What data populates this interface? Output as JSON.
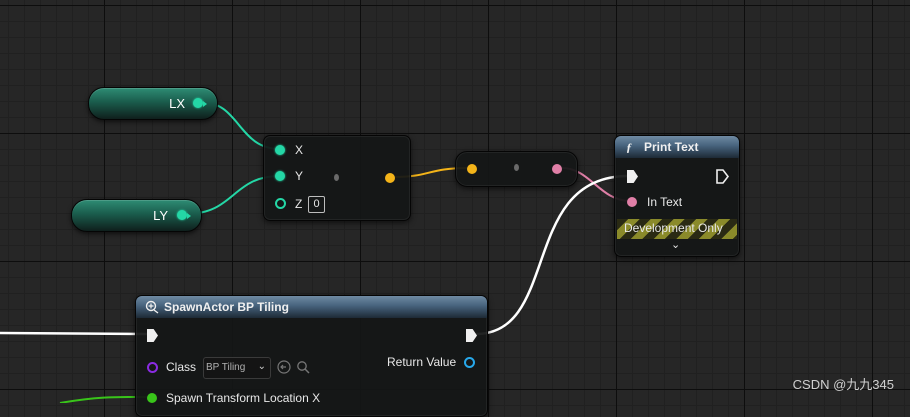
{
  "variables": [
    {
      "label": "LX"
    },
    {
      "label": "LY"
    }
  ],
  "make_vector": {
    "inputs": [
      "X",
      "Y",
      "Z"
    ],
    "z_value": "0"
  },
  "print_text": {
    "title": "Print Text",
    "in_text_label": "In Text",
    "dev_label": "Development Only"
  },
  "spawn_actor": {
    "title": "SpawnActor BP Tiling",
    "return_label": "Return Value",
    "class_label": "Class",
    "class_value": "BP Tiling",
    "location_label": "Spawn Transform Location X"
  },
  "watermark": "CSDN @九九345",
  "colors": {
    "exec_wire": "#ffffff",
    "float_wire": "#24d7a6",
    "vector_wire": "#f4b419",
    "text_wire": "#e07fa7"
  }
}
